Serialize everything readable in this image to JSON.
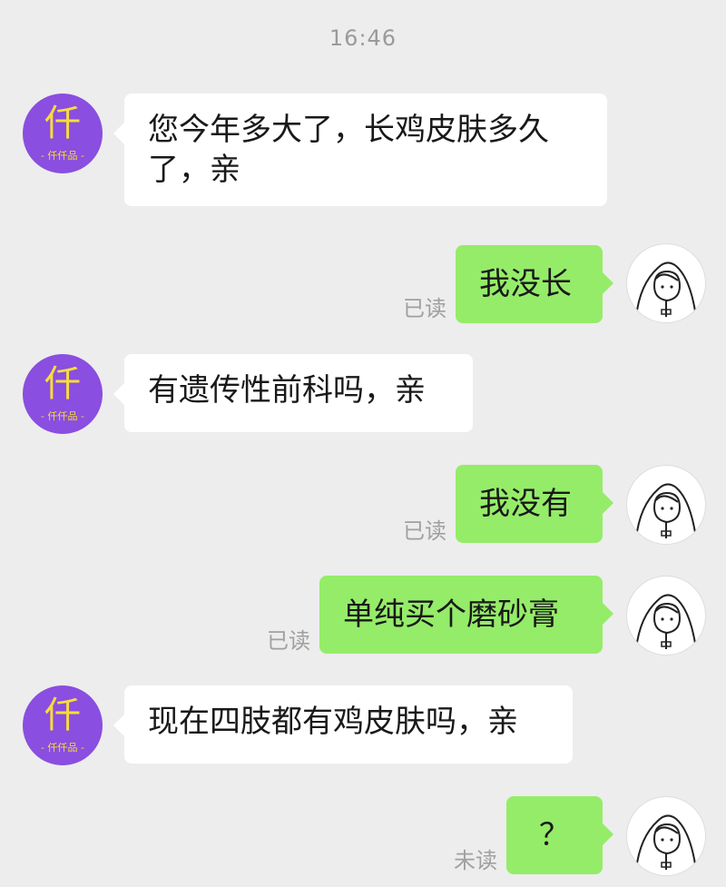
{
  "chat": {
    "time": "16:46",
    "shop_avatar": {
      "char": "仟",
      "sub": "- 仟仟品 -"
    },
    "messages": [
      {
        "side": "left",
        "text": "您今年多大了，长鸡皮肤多久了，亲"
      },
      {
        "side": "right",
        "text": "我没长",
        "status": "已读"
      },
      {
        "side": "left",
        "text": "有遗传性前科吗，亲"
      },
      {
        "side": "right",
        "text": "我没有",
        "status": "已读"
      },
      {
        "side": "right",
        "text": "单纯买个磨砂膏",
        "status": "已读"
      },
      {
        "side": "left",
        "text": "现在四肢都有鸡皮肤吗，亲"
      },
      {
        "side": "right",
        "text": "？",
        "status": "未读"
      }
    ]
  },
  "colors": {
    "background": "#ededed",
    "sent_bubble": "#95ec69",
    "received_bubble": "#ffffff",
    "shop_avatar_bg": "#8a4ee0",
    "shop_avatar_text": "#f7dc3c"
  }
}
